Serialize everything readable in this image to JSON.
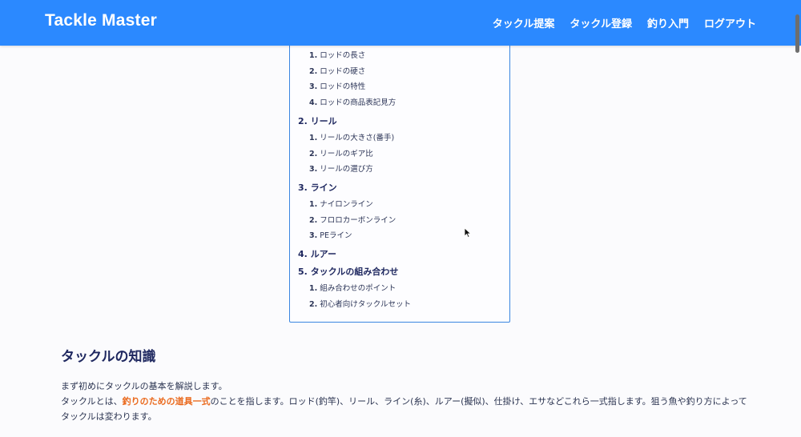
{
  "header": {
    "brand": "Tackle Master",
    "nav": [
      "タックル提案",
      "タックル登録",
      "釣り入門",
      "ログアウト"
    ]
  },
  "toc": {
    "sections": [
      {
        "num": "2.",
        "label": "リール"
      },
      {
        "num": "3.",
        "label": "ライン"
      },
      {
        "num": "4.",
        "label": "ルアー"
      },
      {
        "num": "5.",
        "label": "タックルの組み合わせ"
      }
    ],
    "rod_items": [
      {
        "num": "1.",
        "label": "ロッドの長さ"
      },
      {
        "num": "2.",
        "label": "ロッドの硬さ"
      },
      {
        "num": "3.",
        "label": "ロッドの特性"
      },
      {
        "num": "4.",
        "label": "ロッドの商品表記見方"
      }
    ],
    "reel_items": [
      {
        "num": "1.",
        "label": "リールの大きさ(番手)"
      },
      {
        "num": "2.",
        "label": "リールのギア比"
      },
      {
        "num": "3.",
        "label": "リールの選び方"
      }
    ],
    "line_items": [
      {
        "num": "1.",
        "label": "ナイロンライン"
      },
      {
        "num": "2.",
        "label": "フロロカーボンライン"
      },
      {
        "num": "3.",
        "label": "PEライン"
      }
    ],
    "combo_items": [
      {
        "num": "1.",
        "label": "組み合わせのポイント"
      },
      {
        "num": "2.",
        "label": "初心者向けタックルセット"
      }
    ]
  },
  "article": {
    "heading": "タックルの知識",
    "intro": "まず初めにタックルの基本を解説します。",
    "body_before": "タックルとは、",
    "body_highlight": "釣りのための道具一式",
    "body_after": "のことを指します。ロッド(釣竿)、リール、ライン(糸)、ルアー(擬似)、仕掛け、エサなどこれら一式指します。狙う魚や釣り方によってタックルは変わります。"
  },
  "colors": {
    "header_bg": "#2b89ff",
    "toc_border": "#3a86e0",
    "heading": "#1f2860",
    "highlight": "#ea6a1e"
  }
}
